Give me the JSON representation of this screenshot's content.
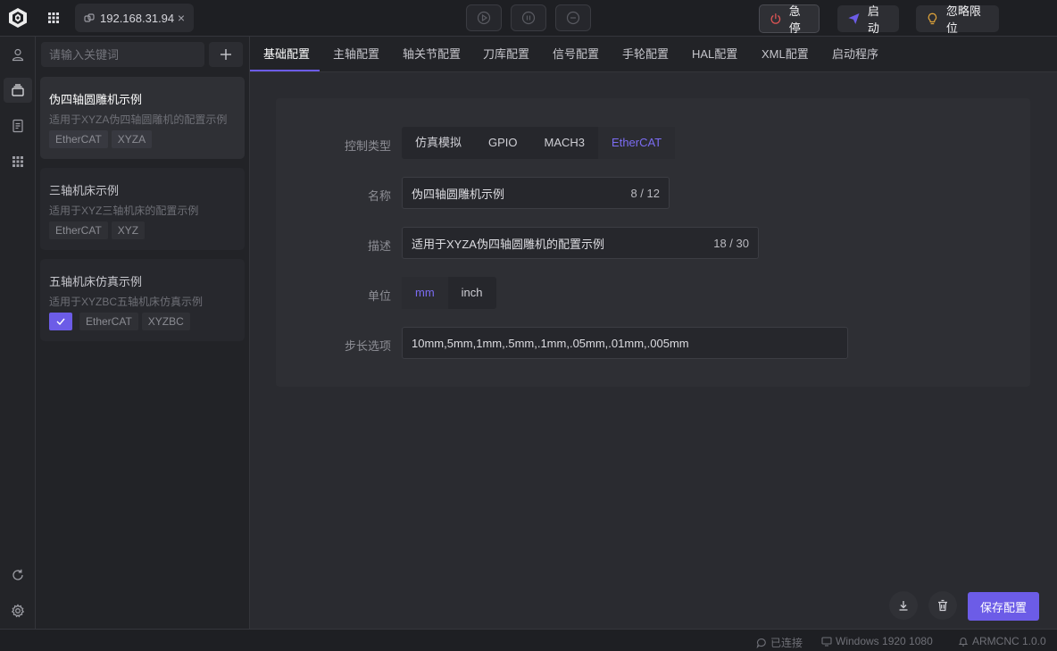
{
  "colors": {
    "accent": "#6c5ce7",
    "estop": "#e05555",
    "ignore": "#e0a43a"
  },
  "topbar": {
    "connection_ip": "192.168.31.94",
    "close_glyph": "×",
    "estop_label": "急停",
    "start_label": "启动",
    "ignore_limit_label": "忽略限位"
  },
  "search": {
    "placeholder": "请输入关键词"
  },
  "configs": [
    {
      "title": "伪四轴圆雕机示例",
      "desc": "适用于XYZA伪四轴圆雕机的配置示例",
      "tags": [
        "EtherCAT",
        "XYZA"
      ]
    },
    {
      "title": "三轴机床示例",
      "desc": "适用于XYZ三轴机床的配置示例",
      "tags": [
        "EtherCAT",
        "XYZ"
      ]
    },
    {
      "title": "五轴机床仿真示例",
      "desc": "适用于XYZBC五轴机床仿真示例",
      "tags": [
        "EtherCAT",
        "XYZBC"
      ],
      "checked": true
    }
  ],
  "tabs": [
    "基础配置",
    "主轴配置",
    "轴关节配置",
    "刀库配置",
    "信号配置",
    "手轮配置",
    "HAL配置",
    "XML配置",
    "启动程序"
  ],
  "form": {
    "control_type_label": "控制类型",
    "control_type_options": [
      "仿真模拟",
      "GPIO",
      "MACH3",
      "EtherCAT"
    ],
    "control_type_selected": "EtherCAT",
    "name_label": "名称",
    "name_value": "伪四轴圆雕机示例",
    "name_count": "8 / 12",
    "desc_label": "描述",
    "desc_value": "适用于XYZA伪四轴圆雕机的配置示例",
    "desc_count": "18 / 30",
    "unit_label": "单位",
    "unit_options": [
      "mm",
      "inch"
    ],
    "unit_selected": "mm",
    "step_label": "步长选项",
    "step_value": "10mm,5mm,1mm,.5mm,.1mm,.05mm,.01mm,.005mm"
  },
  "actions": {
    "save_label": "保存配置"
  },
  "status": {
    "connected": "已连接",
    "system": "Windows 1920 1080",
    "version": "ARMCNC 1.0.0"
  }
}
